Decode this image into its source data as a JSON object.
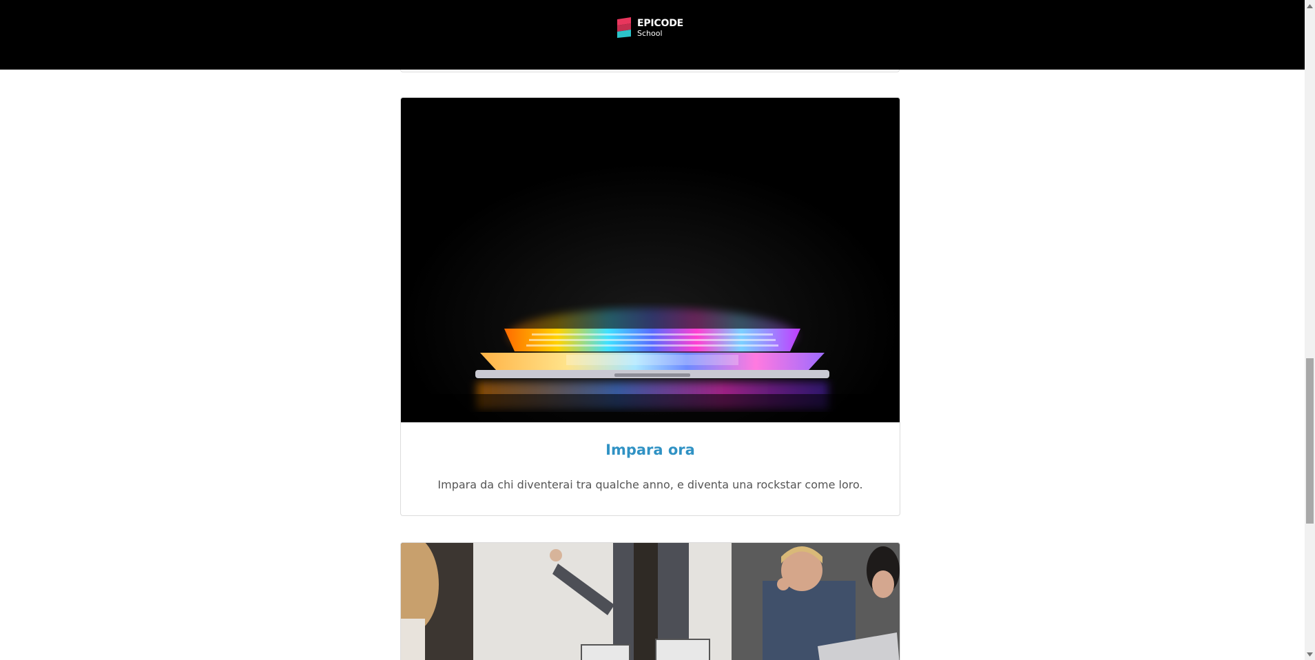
{
  "header": {
    "logo_title": "EPICODE",
    "logo_subtitle": "School",
    "background": "#000000"
  },
  "cards": [
    {
      "image_icon": "laptop-photo",
      "title": "Impara ora",
      "text": "Impara da chi diventerai tra qualche anno, e diventa una rockstar come loro."
    },
    {
      "image_icon": "office-meeting-photo"
    }
  ],
  "colors": {
    "accent": "#3092c4",
    "logo_red": "#e8365d",
    "logo_teal": "#2bc3c9",
    "body_text": "#555555"
  }
}
